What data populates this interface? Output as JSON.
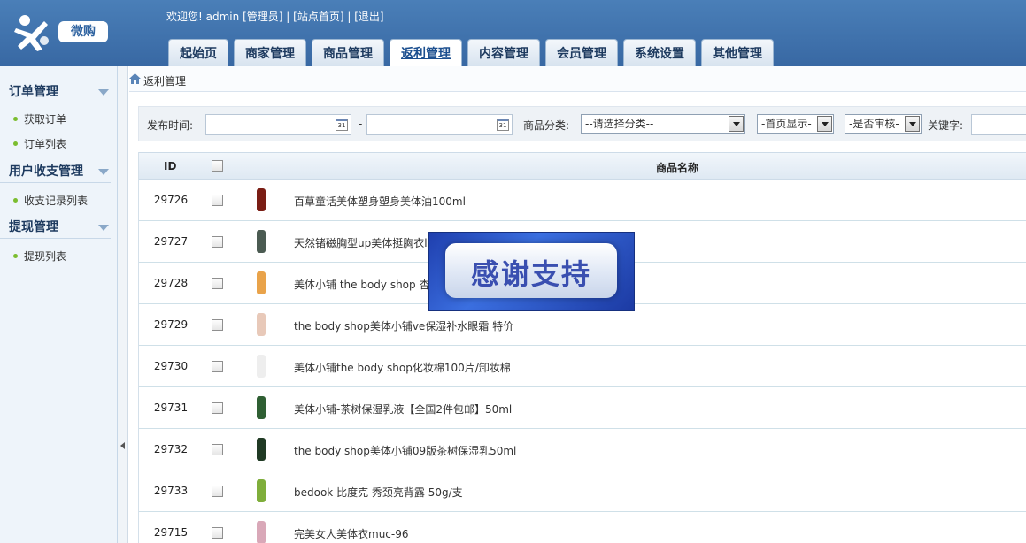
{
  "header": {
    "logo_badge": "微购",
    "welcome": "欢迎您! admin",
    "role": "[管理员]",
    "sep": "|",
    "site_home": "[站点首页]",
    "logout": "[退出]"
  },
  "tabs": [
    {
      "label": "起始页",
      "active": false
    },
    {
      "label": "商家管理",
      "active": false
    },
    {
      "label": "商品管理",
      "active": false
    },
    {
      "label": "返利管理",
      "active": true
    },
    {
      "label": "内容管理",
      "active": false
    },
    {
      "label": "会员管理",
      "active": false
    },
    {
      "label": "系统设置",
      "active": false
    },
    {
      "label": "其他管理",
      "active": false
    }
  ],
  "sidebar": {
    "groups": [
      {
        "title": "订单管理",
        "items": [
          "获取订单",
          "订单列表"
        ]
      },
      {
        "title": "用户收支管理",
        "items": [
          "收支记录列表"
        ]
      },
      {
        "title": "提现管理",
        "items": [
          "提现列表"
        ]
      }
    ]
  },
  "breadcrumb": "返利管理",
  "filter": {
    "publish_time_label": "发布时间:",
    "range_sep": "-",
    "date_from": "",
    "date_to": "",
    "calendar_glyph": "31",
    "category_label": "商品分类:",
    "category_value": "--请选择分类--",
    "homepage_value": "-首页显示-",
    "audit_value": "-是否审核-",
    "keyword_label": "关键字:",
    "keyword_value": ""
  },
  "table": {
    "col_id": "ID",
    "col_name": "商品名称",
    "rows": [
      {
        "id": "29726",
        "name": "百草童话美体塑身塑身美体油100ml",
        "thumb_color": "#7a1d14"
      },
      {
        "id": "29727",
        "name": "天然锗磁胸型up美体挺胸衣l0",
        "thumb_color": "#4b5b52"
      },
      {
        "id": "29728",
        "name": "美体小铺 the body shop 杏仁",
        "thumb_color": "#e9a34a"
      },
      {
        "id": "29729",
        "name": "the body shop美体小铺ve保湿补水眼霜 特价",
        "thumb_color": "#e8c9b9"
      },
      {
        "id": "29730",
        "name": "美体小铺the body shop化妆棉100片/卸妆棉",
        "thumb_color": "#eeeeee"
      },
      {
        "id": "29731",
        "name": "美体小铺-茶树保湿乳液【全国2件包邮】50ml",
        "thumb_color": "#2f5f33"
      },
      {
        "id": "29732",
        "name": "the body shop美体小铺09版茶树保湿乳50ml",
        "thumb_color": "#203a24"
      },
      {
        "id": "29733",
        "name": "bedook 比度克 秀颈亮背露 50g/支",
        "thumb_color": "#7fae3b"
      },
      {
        "id": "29715",
        "name": "完美女人美体衣muc-96",
        "thumb_color": "#d9a8b8"
      }
    ]
  },
  "overlay": {
    "text": "感谢支持"
  }
}
